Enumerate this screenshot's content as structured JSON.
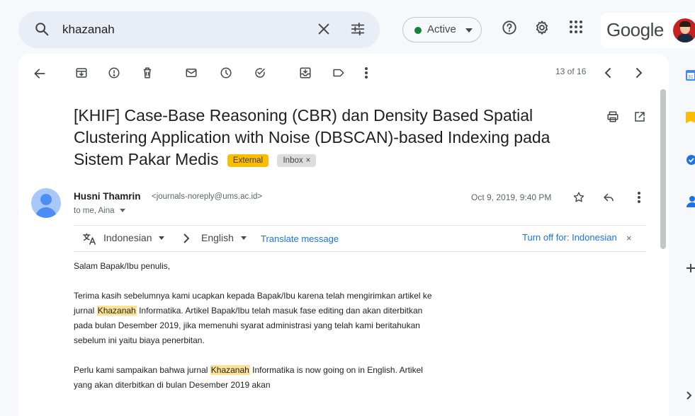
{
  "search": {
    "query": "khazanah"
  },
  "status": {
    "label": "Active"
  },
  "brand": {
    "logo_text": "Google"
  },
  "toolbar": {
    "pager": "13 of 16"
  },
  "email": {
    "subject": "[KHIF] Case-Base Reasoning (CBR) dan Density Based Spatial Clustering Application with Noise (DBSCAN)-based Indexing pada Sistem Pakar Medis",
    "labels": {
      "external": "External",
      "inbox": "Inbox",
      "inbox_remove": "×"
    },
    "sender_name": "Husni Thamrin",
    "sender_email": "<journals-noreply@ums.ac.id>",
    "recipients": "to me, Aina",
    "date": "Oct 9, 2019, 9:40 PM"
  },
  "translate": {
    "from_lang": "Indonesian",
    "to_lang": "English",
    "link": "Translate message",
    "turn_off": "Turn off for: Indonesian",
    "close": "×"
  },
  "body": {
    "greeting": "Salam Bapak/Ibu penulis,",
    "p1_before": "Terima kasih sebelumnya kami ucapkan kepada Bapak/Ibu karena telah mengirimkan artikel ke jurnal ",
    "p1_highlight": "Khazanah",
    "p1_after": " Informatika. Artikel Bapak/Ibu telah masuk fase editing dan akan diterbitkan pada bulan Desember 2019, jika memenuhi syarat administrasi yang telah kami beritahukan sebelum ini yaitu biaya penerbitan.",
    "p2_before": "Perlu kami sampaikan bahwa jurnal ",
    "p2_highlight": "Khazanah",
    "p2_after": " Informatika is now going on in English. Artikel yang akan diterbitkan di bulan Desember 2019 akan"
  },
  "colors": {
    "page_bg": "#f6f8fc",
    "search_bg": "#e9eef6",
    "external_badge": "#fbbc04",
    "highlight": "#fde293",
    "link": "#1a73e8",
    "status_dot": "#188038"
  }
}
